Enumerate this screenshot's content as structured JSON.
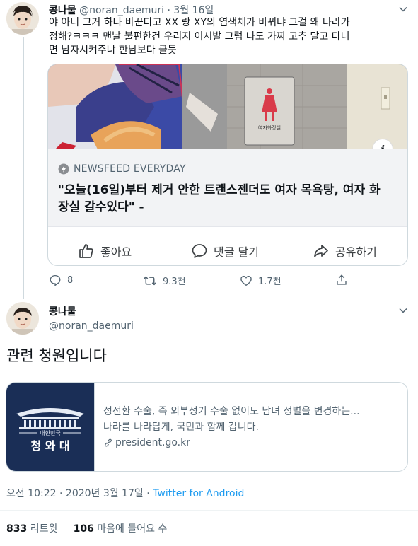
{
  "tweet1": {
    "display_name": "콩나물",
    "handle": "@noran_daemuri",
    "separator": "·",
    "date": "3월 16일",
    "text_line1": "야 아니 그거 하나 바꾼다고 XX 랑 XY의 염색체가 바뀌냐 그걸 왜 나라가",
    "text_line2": "정해?ㅋㅋㅋ 맨날 불편한건 우리지 이시발 그럼 나도 가짜 고추 달고 다니",
    "text_line3": "면 남자시켜주냐 한남보다 클듯",
    "card": {
      "sign_text": "여자화장실",
      "source": "NEWSFEED EVERYDAY",
      "headline_line1": "\"오늘(16일)부터 제거 안한 트랜스젠더도 여자 목욕탕, 여자 화",
      "headline_line2": "장실 갈수있다\" -",
      "like_label": "좋아요",
      "comment_label": "댓글 달기",
      "share_label": "공유하기",
      "info_glyph": "i"
    },
    "replies": "8",
    "retweets": "9.3천",
    "likes": "1.7천"
  },
  "tweet2": {
    "display_name": "콩나물",
    "handle": "@noran_daemuri",
    "text": "관련 청원입니다",
    "card": {
      "logo_small": "대한민국",
      "logo_big": "청 와 대",
      "title": "성전환 수술, 즉 외부성기 수술 없이도 남녀 성별을 변경하는...",
      "description": "나라를 나라답게, 국민과 함께 갑니다.",
      "domain": "president.go.kr"
    },
    "timestamp": "오전 10:22 · 2020년 3월 17일 ·",
    "client": "Twitter for Android",
    "retweet_count": "833",
    "retweet_label": "리트윗",
    "like_count": "106",
    "like_label": "마음에 들어요 수"
  },
  "colors": {
    "twitter_blue": "#1d9bf0",
    "navy": "#1a2e56",
    "gray_text": "#536471",
    "divider": "#eff3f4"
  }
}
